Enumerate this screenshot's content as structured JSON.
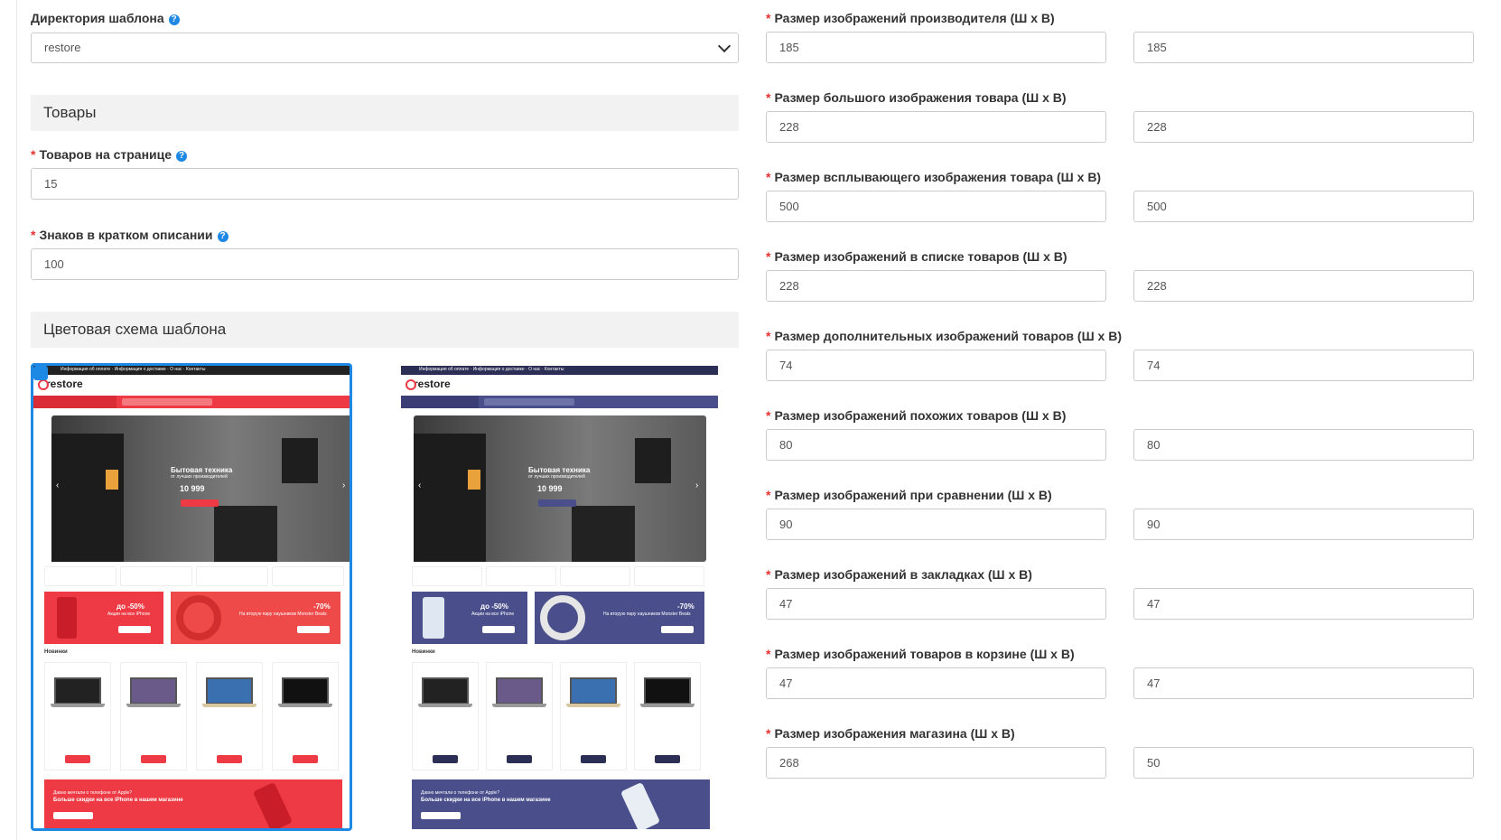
{
  "left": {
    "template_dir": {
      "label": "Директория шаблона",
      "value": "restore"
    },
    "products_section": "Товары",
    "products_per_page": {
      "label": "Товаров на странице",
      "value": "15"
    },
    "short_desc_chars": {
      "label": "Знаков в кратком описании",
      "value": "100"
    },
    "color_scheme_section": "Цветовая схема шаблона",
    "themes": [
      {
        "selected": true,
        "accent": "#ee3a44",
        "brand": "restore",
        "banner_title": "Бытовая техника",
        "banner_sub": "от лучших производителей",
        "price": "10 999",
        "promo1": "до -50%",
        "promo1_sub": "Акции на все iPhone",
        "promo2": "-70%",
        "promo2_sub": "На вторую пару наушников Monster Beats",
        "section": "Новинки",
        "bottom_line1": "Давно мечтали о телефоне от Apple?",
        "bottom_line2": "Больше скидки на все iPhone в нашем магазине"
      },
      {
        "selected": false,
        "accent": "#4a4f8c",
        "brand": "restore",
        "banner_title": "Бытовая техника",
        "banner_sub": "от лучших производителей",
        "price": "10 999",
        "promo1": "до -50%",
        "promo1_sub": "Акции на все iPhone",
        "promo2": "-70%",
        "promo2_sub": "На вторую пару наушников Monster Beats",
        "section": "Новинки",
        "bottom_line1": "Давно мечтали о телефоне от Apple?",
        "bottom_line2": "Больше скидки на все iPhone в нашем магазине"
      }
    ]
  },
  "right": {
    "fields": [
      {
        "label": "Размер изображений производителя (Ш х В)",
        "w": "185",
        "h": "185"
      },
      {
        "label": "Размер большого изображения товара (Ш х В)",
        "w": "228",
        "h": "228"
      },
      {
        "label": "Размер всплывающего изображения товара (Ш х В)",
        "w": "500",
        "h": "500"
      },
      {
        "label": "Размер изображений в списке товаров (Ш х В)",
        "w": "228",
        "h": "228"
      },
      {
        "label": "Размер дополнительных изображений товаров (Ш х В)",
        "w": "74",
        "h": "74"
      },
      {
        "label": "Размер изображений похожих товаров (Ш х В)",
        "w": "80",
        "h": "80"
      },
      {
        "label": "Размер изображений при сравнении (Ш х В)",
        "w": "90",
        "h": "90"
      },
      {
        "label": "Размер изображений в закладках (Ш х В)",
        "w": "47",
        "h": "47"
      },
      {
        "label": "Размер изображений товаров в корзине (Ш х В)",
        "w": "47",
        "h": "47"
      },
      {
        "label": "Размер изображения магазина (Ш х В)",
        "w": "268",
        "h": "50"
      }
    ]
  }
}
